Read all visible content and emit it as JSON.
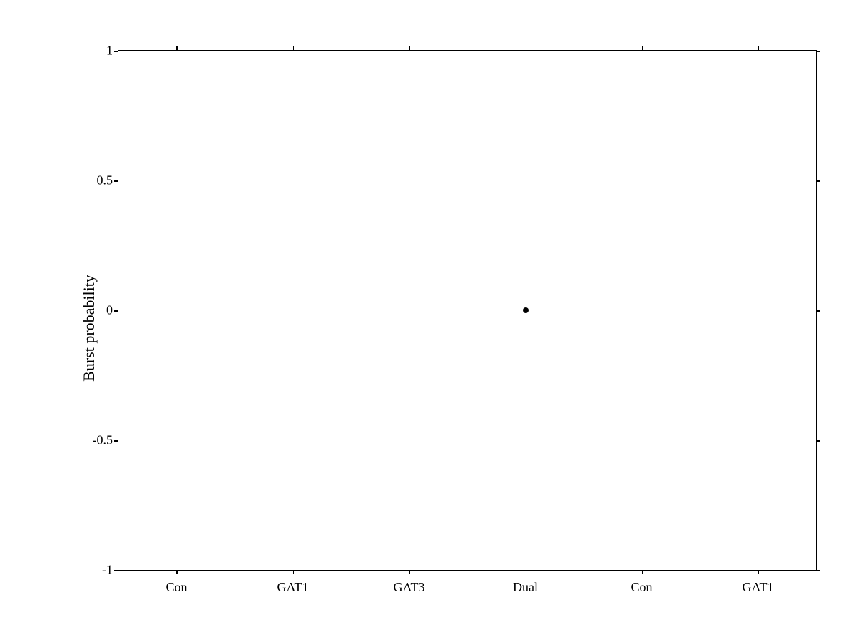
{
  "chart": {
    "y_axis_label": "Burst probability",
    "y_min": -1,
    "y_max": 1,
    "y_ticks": [
      {
        "value": 1,
        "label": "1"
      },
      {
        "value": 0.5,
        "label": "0.5"
      },
      {
        "value": 0,
        "label": "0"
      },
      {
        "value": -0.5,
        "label": "-0.5"
      },
      {
        "value": -1,
        "label": "-1"
      }
    ],
    "x_labels": [
      "Con",
      "GAT1",
      "GAT3",
      "Dual",
      "Con",
      "GAT1"
    ],
    "data_points": [
      {
        "x_index": 3,
        "y_value": 0.0,
        "label": "Dual, ~0"
      }
    ]
  }
}
